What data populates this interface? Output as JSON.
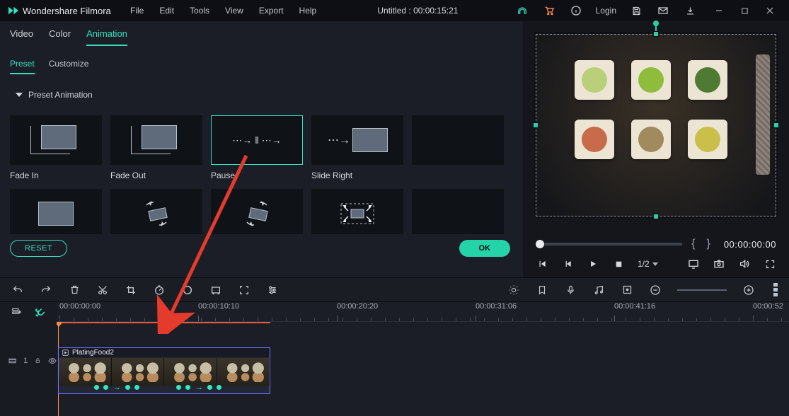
{
  "brand": "Wondershare Filmora",
  "menu": {
    "file": "File",
    "edit": "Edit",
    "tools": "Tools",
    "view": "View",
    "export": "Export",
    "help": "Help"
  },
  "title": "Untitled : 00:00:15:21",
  "top_right": {
    "login": "Login"
  },
  "prop_tabs": {
    "video": "Video",
    "color": "Color",
    "animation": "Animation"
  },
  "sub_tabs": {
    "preset": "Preset",
    "customize": "Customize"
  },
  "section": "Preset Animation",
  "anims": {
    "fade_in": "Fade In",
    "fade_out": "Fade Out",
    "pause": "Pause",
    "slide_right": "Slide Right"
  },
  "footer": {
    "reset": "RESET",
    "ok": "OK"
  },
  "preview": {
    "timecode": "00:00:00:00",
    "brace_open": "{",
    "brace_close": "}",
    "speed": "1/2"
  },
  "ruler": {
    "t0": "00:00:00:00",
    "t1": "00:00:10:10",
    "t2": "00:00:20:20",
    "t3": "00:00:31:06",
    "t4": "00:00:41:16",
    "t5": "00:00:52"
  },
  "clip": {
    "name": "PlatingFood2"
  },
  "track": {
    "label": "1"
  }
}
